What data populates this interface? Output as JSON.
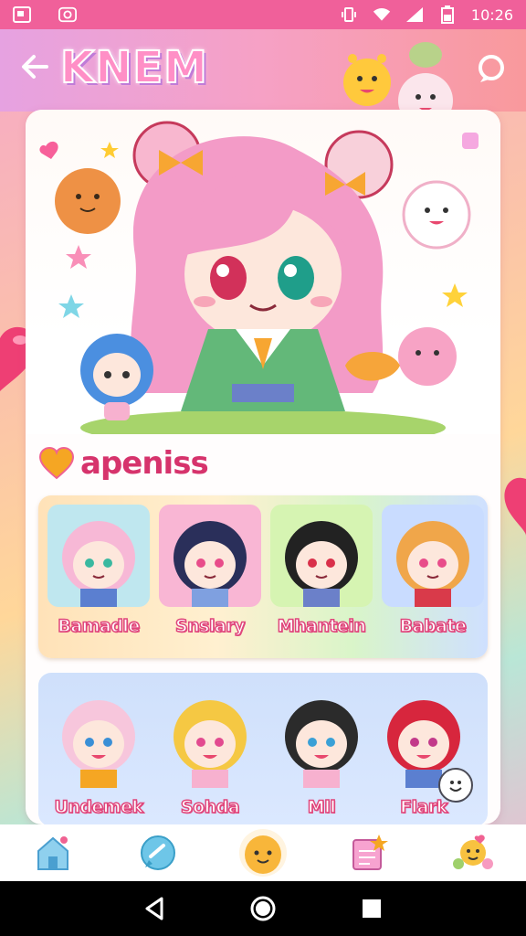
{
  "status_bar": {
    "time": "10:26"
  },
  "header": {
    "logo_text": "KNEM",
    "back_icon": "arrow-left-icon",
    "chat_icon": "chat-bubble-icon"
  },
  "section": {
    "title": "apeniss"
  },
  "row1": [
    {
      "name": "Bamadle",
      "bg": "#bfe7ef",
      "hair": "#f7b8d6",
      "eyes": "#3ab8a0"
    },
    {
      "name": "Snslary",
      "bg": "#f9b6d4",
      "hair": "#2a2f5a",
      "eyes": "#e84c8a"
    },
    {
      "name": "Mhantein",
      "bg": "#d6f4b2",
      "hair": "#222222",
      "eyes": "#d9304a"
    },
    {
      "name": "Babate",
      "bg": "#c9dcff",
      "hair": "#f0a64a",
      "eyes": "#e84c8a"
    }
  ],
  "row2": [
    {
      "name": "Undemek",
      "bg": "#dbe8ff",
      "hair": "#f7c6dc",
      "eyes": "#3a8fd6"
    },
    {
      "name": "Sohda",
      "bg": "#dbe8ff",
      "hair": "#f5c843",
      "eyes": "#e24a8f"
    },
    {
      "name": "Mll",
      "bg": "#dbe8ff",
      "hair": "#2b2b2b",
      "eyes": "#3aa0d6"
    },
    {
      "name": "Flark",
      "bg": "#dbe8ff",
      "hair": "#d7263d",
      "eyes": "#c23a8a"
    }
  ],
  "tabs": [
    {
      "icon": "home-icon"
    },
    {
      "icon": "chat-icon"
    },
    {
      "icon": "mascot-icon"
    },
    {
      "icon": "notes-icon"
    },
    {
      "icon": "friends-icon"
    }
  ],
  "colors": {
    "accent": "#f0609a",
    "title": "#d6336c"
  }
}
